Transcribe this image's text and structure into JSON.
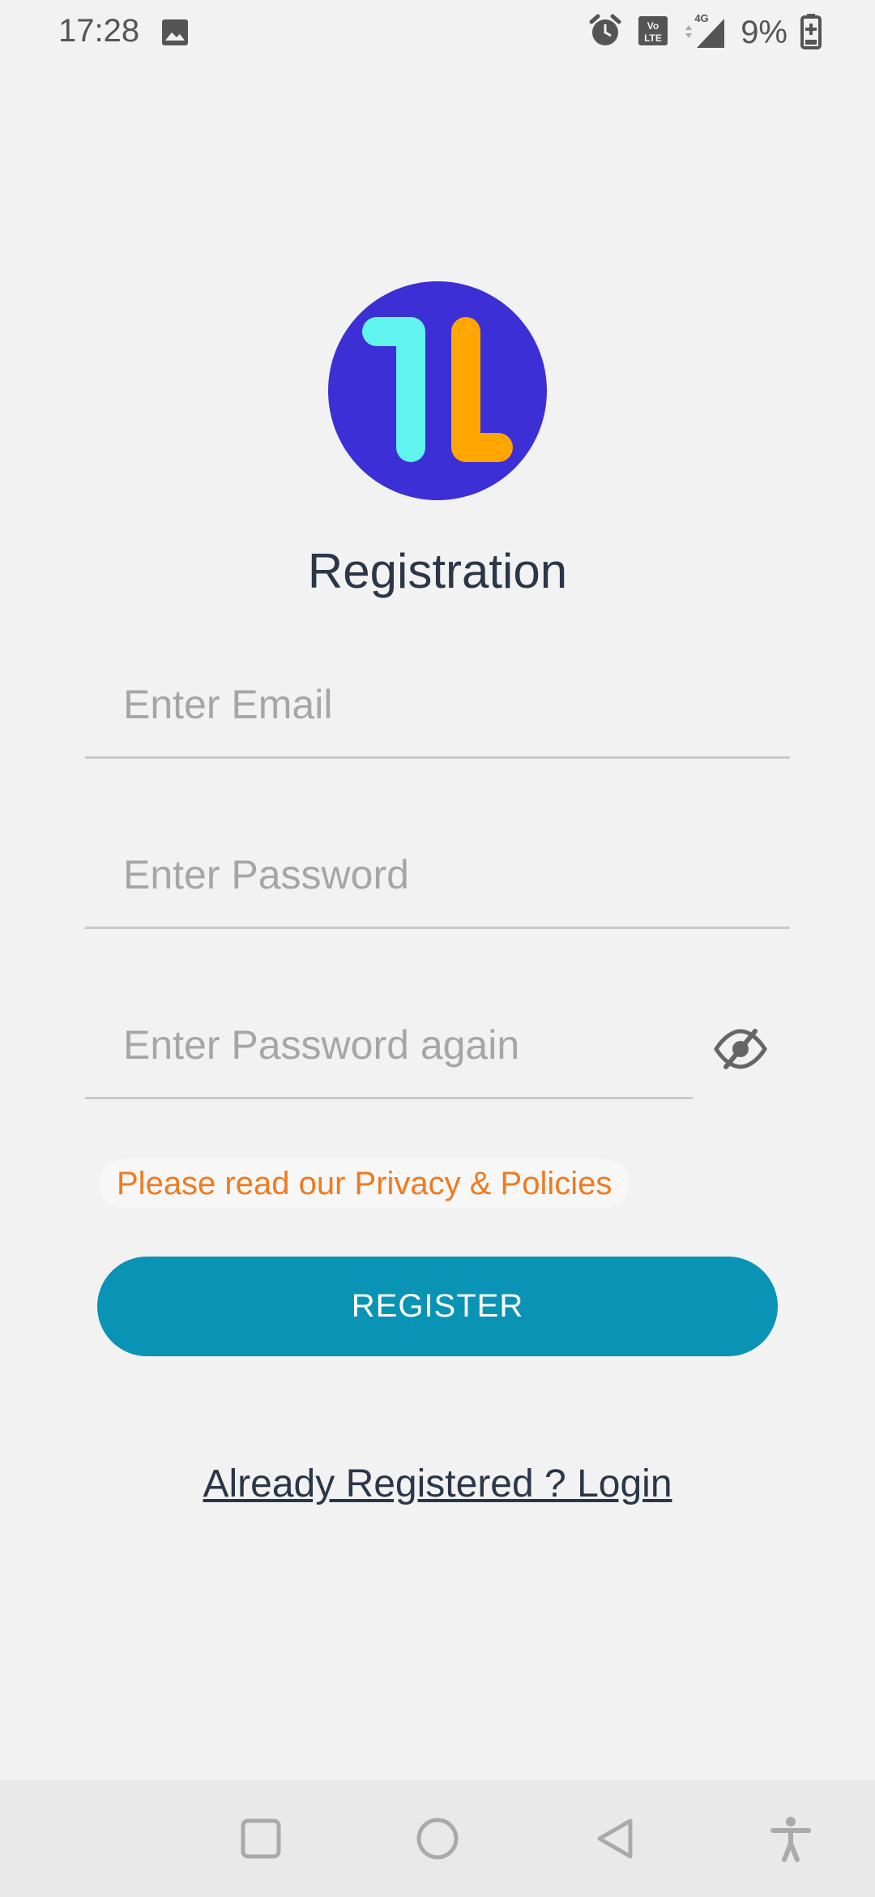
{
  "status_bar": {
    "time": "17:28",
    "battery_percent": "9%",
    "network_label": "4G",
    "volte_label": "Vo LTE",
    "icons": [
      "gallery-icon",
      "alarm-icon",
      "volte-icon",
      "signal-icon",
      "battery-charging-icon"
    ]
  },
  "logo": {
    "icon": "app-logo-icon",
    "colors": {
      "background": "#3c2fd6",
      "left_stroke": "#5ff5ee",
      "right_stroke": "#ffa600"
    }
  },
  "page": {
    "title": "Registration"
  },
  "form": {
    "email": {
      "placeholder": "Enter Email",
      "value": ""
    },
    "password": {
      "placeholder": "Enter Password",
      "value": ""
    },
    "password_again": {
      "placeholder": "Enter Password again",
      "value": ""
    },
    "toggle_visibility_icon": "eye-off-icon",
    "privacy_text": "Please read our Privacy & Policies",
    "register_label": "REGISTER",
    "login_link": "Already Registered ? Login"
  },
  "colors": {
    "background": "#f2f2f2",
    "title_text": "#2b3648",
    "placeholder": "#a6a6a6",
    "underline": "#c9c9c9",
    "privacy_text": "#f07a1f",
    "register_button": "#0993b5",
    "register_text": "#ffffff",
    "nav_bar": "#e9e9e9"
  },
  "nav_bar": {
    "buttons": [
      "recents-square-icon",
      "home-circle-icon",
      "back-triangle-icon",
      "accessibility-icon"
    ]
  }
}
